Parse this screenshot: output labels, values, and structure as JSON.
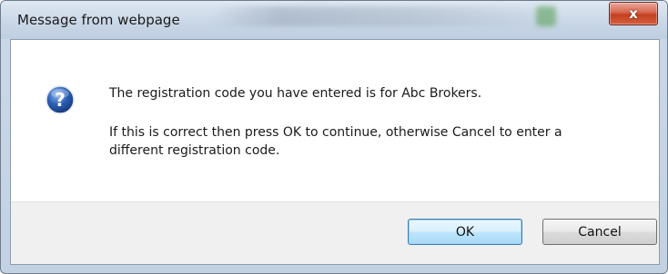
{
  "window": {
    "title": "Message from webpage",
    "close_glyph": "x"
  },
  "dialog": {
    "icon": "question-icon",
    "message_line1": "The registration code you have entered is for Abc Brokers.",
    "message_line2": "If this is correct then press OK to continue, otherwise Cancel to enter a different registration code."
  },
  "buttons": {
    "ok_label": "OK",
    "cancel_label": "Cancel"
  },
  "colors": {
    "accent": "#3c7fb1",
    "close": "#c3401f",
    "icon_blue": "#2b5fb4"
  }
}
